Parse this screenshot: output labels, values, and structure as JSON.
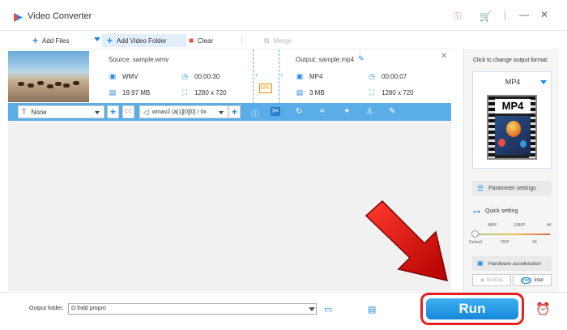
{
  "app": {
    "title": "Video Converter"
  },
  "toolbar": {
    "add_files": "Add Files",
    "add_video_folder": "Add Video Folder",
    "clear": "Clear",
    "merge": "Merge"
  },
  "file": {
    "source": "Source: sample.wmv",
    "output": "Output: sample.mp4",
    "src_format": "WMV",
    "src_duration": "00:00:30",
    "src_size": "19.97 MB",
    "src_resolution": "1280 x 720",
    "out_format": "MP4",
    "out_duration": "00:00:07",
    "out_size": "3 MB",
    "out_resolution": "1280 x 720",
    "gpu_label": "GPU"
  },
  "editbar": {
    "subtitle_value": "None",
    "audio_track": "wmav2 (a[1][0][0] / 0x"
  },
  "panel": {
    "caption": "Click to change output format:",
    "format": "MP4",
    "format_icon_text": "MP4",
    "parameter_settings": "Parameter settings",
    "quick_setting": "Quick setting",
    "ticks_top": [
      "480P",
      "1080P",
      "4K"
    ],
    "ticks_bottom": [
      "Default",
      "720P",
      "2K"
    ],
    "hardware_acceleration": "Hardware acceleration",
    "nvidia": "NVIDIA",
    "intel_logo": "intel",
    "intel": "Intel"
  },
  "bottom": {
    "output_folder_label": "Output folder:",
    "output_folder_value": "D:\\hdd propro",
    "run": "Run"
  },
  "colors": {
    "accent": "#1e88e5",
    "run_border": "#e62020",
    "editbar": "#5aaee8"
  }
}
